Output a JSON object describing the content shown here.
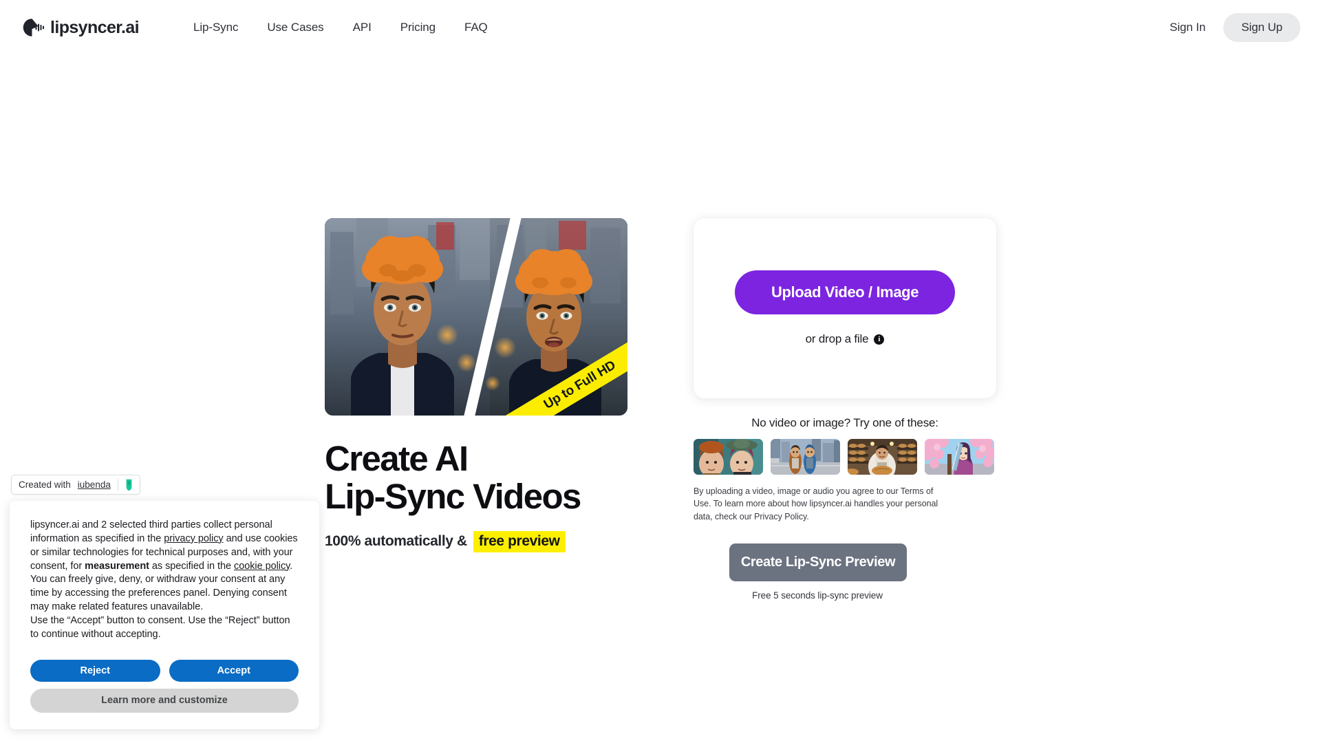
{
  "header": {
    "logo": {
      "icon": "lipsync-wave-icon",
      "text": "lipsyncer.ai"
    },
    "nav": [
      {
        "label": "Lip-Sync"
      },
      {
        "label": "Use Cases"
      },
      {
        "label": "API"
      },
      {
        "label": "Pricing"
      },
      {
        "label": "FAQ"
      }
    ],
    "sign_in_label": "Sign In",
    "sign_up_label": "Sign Up"
  },
  "hero": {
    "ribbon_label": "Up to Full HD",
    "image_alt": "before-after-lipsync-comparison",
    "title": "Create AI\nLip-Sync Videos",
    "subtitle_prefix": "100% automatically &",
    "subtitle_highlight": "free preview"
  },
  "upload": {
    "button_label": "Upload Video / Image",
    "drop_label": "or drop a file",
    "info_glyph": "i",
    "samples_label": "No video or image? Try one of these:",
    "samples": [
      {
        "name": "sample-two-women-portrait"
      },
      {
        "name": "sample-two-kids-city"
      },
      {
        "name": "sample-baker-bread"
      },
      {
        "name": "sample-anime-girl-sakura"
      }
    ],
    "disclaimer": "By uploading a video, image or audio you agree to our Terms of Use. To learn more about how lipsyncer.ai handles your personal data, check our Privacy Policy.",
    "preview_button_label": "Create Lip-Sync Preview",
    "preview_note": "Free 5 seconds lip-sync preview"
  },
  "iubenda": {
    "prefix": "Created with",
    "link": "iubenda",
    "icon": "iubenda-shield-icon"
  },
  "cookie": {
    "p1_a": "lipsyncer.ai and 2 selected third parties collect personal information as specified in the ",
    "p1_link1": "privacy policy",
    "p1_b": " and use cookies or similar technologies for technical purposes and, with your consent, for ",
    "p1_bold": "measurement",
    "p1_c": " as specified in the ",
    "p1_link2": "cookie policy",
    "p1_d": ".",
    "p2": "You can freely give, deny, or withdraw your consent at any time by accessing the preferences panel. Denying consent may make related features unavailable.",
    "p3": "Use the “Accept” button to consent. Use the “Reject” button to continue without accepting.",
    "reject_label": "Reject",
    "accept_label": "Accept",
    "learn_more_label": "Learn more and customize"
  },
  "colors": {
    "accent_purple": "#7c24e0",
    "highlight_yellow": "#fcf000",
    "ribbon_yellow": "#fced00",
    "cookie_blue": "#0a6cc4",
    "preview_grey": "#6b7280",
    "signup_grey": "#e9eaec"
  }
}
